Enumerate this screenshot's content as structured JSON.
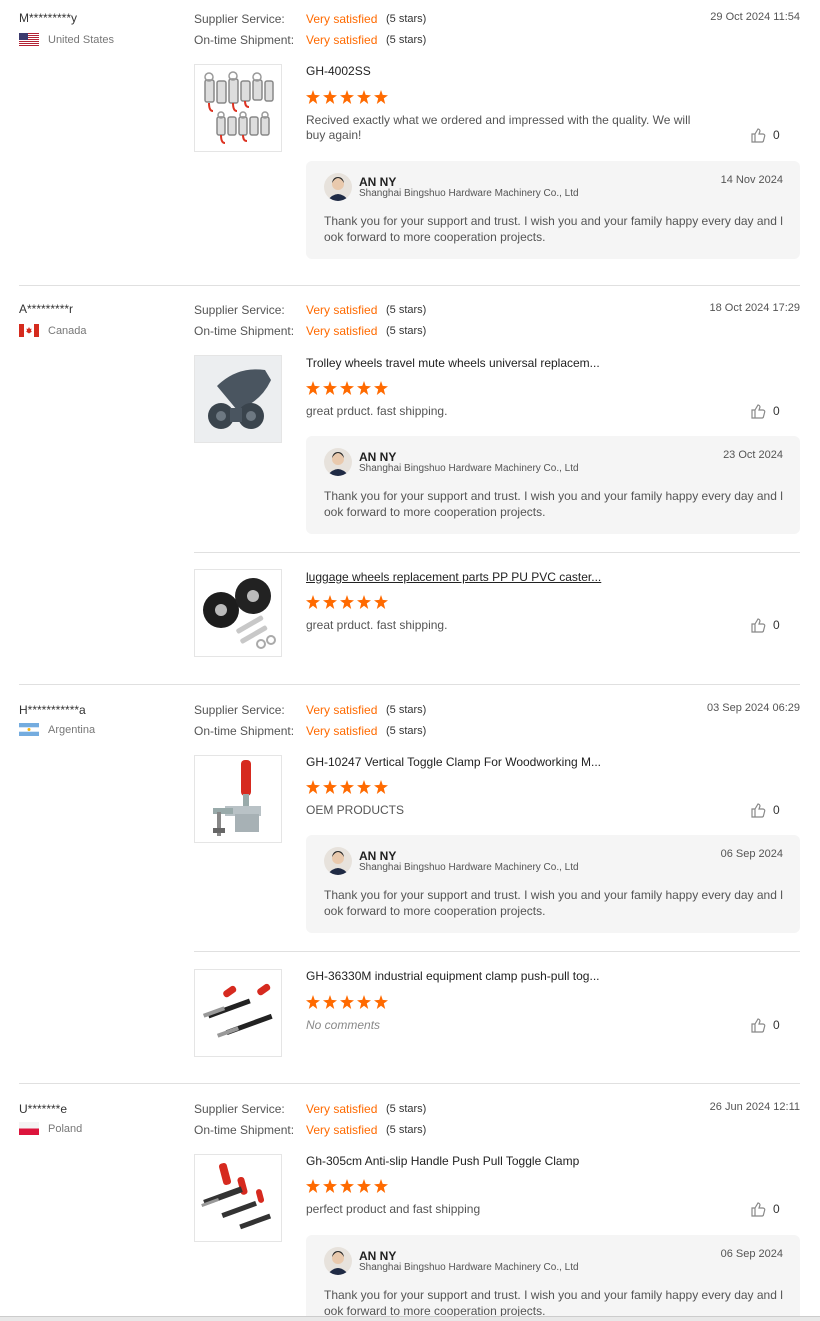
{
  "like_icon": "thumbs-up-icon",
  "colors": {
    "accent": "#ff6a00",
    "reply_bg": "#f5f5f5"
  },
  "labels": {
    "supplier_service": "Supplier Service:",
    "on_time_shipment": "On-time Shipment:"
  },
  "reviews": [
    {
      "buyer": "M*********y",
      "country": "United States",
      "date": "29 Oct 2024 11:54",
      "supplier_value": "Very satisfied",
      "supplier_stars": "(5 stars)",
      "shipment_value": "Very satisfied",
      "shipment_stars": "(5 stars)",
      "products": [
        {
          "title": "GH-4002SS",
          "rating": 5,
          "comment": "Recived exactly what we ordered and impressed with the quality.   We will buy again!",
          "likes": "0",
          "reply": {
            "name": "AN NY",
            "company": "Shanghai Bingshuo Hardware Machinery Co., Ltd",
            "date": "14 Nov 2024",
            "text": "Thank you for your support and trust. I wish you and your family happy every day and look forward to more cooperation projects."
          }
        }
      ]
    },
    {
      "buyer": "A*********r",
      "country": "Canada",
      "date": "18 Oct 2024 17:29",
      "supplier_value": "Very satisfied",
      "supplier_stars": "(5 stars)",
      "shipment_value": "Very satisfied",
      "shipment_stars": "(5 stars)",
      "products": [
        {
          "title": "Trolley wheels travel mute wheels universal replacem...",
          "rating": 5,
          "comment": "great prduct. fast shipping.",
          "likes": "0",
          "reply": {
            "name": "AN NY",
            "company": "Shanghai Bingshuo Hardware Machinery Co., Ltd",
            "date": "23 Oct 2024",
            "text": "Thank you for your support and trust. I wish you and your family happy every day and look forward to more cooperation projects."
          }
        },
        {
          "title": "luggage wheels replacement parts PP PU PVC caster...",
          "rating": 5,
          "comment": "great prduct. fast shipping.",
          "likes": "0"
        }
      ]
    },
    {
      "buyer": "H***********a",
      "country": "Argentina",
      "date": "03 Sep 2024 06:29",
      "supplier_value": "Very satisfied",
      "supplier_stars": "(5 stars)",
      "shipment_value": "Very satisfied",
      "shipment_stars": "(5 stars)",
      "products": [
        {
          "title": "GH-10247 Vertical Toggle Clamp For Woodworking M...",
          "rating": 5,
          "comment": "OEM PRODUCTS",
          "likes": "0",
          "reply": {
            "name": "AN NY",
            "company": "Shanghai Bingshuo Hardware Machinery Co., Ltd",
            "date": "06 Sep 2024",
            "text": "Thank you for your support and trust. I wish you and your family happy every day and look forward to more cooperation projects."
          }
        },
        {
          "title": "GH-36330M industrial equipment clamp push-pull tog...",
          "rating": 5,
          "comment": "No comments",
          "likes": "0"
        }
      ]
    },
    {
      "buyer": "U*******e",
      "country": "Poland",
      "date": "26 Jun 2024 12:11",
      "supplier_value": "Very satisfied",
      "supplier_stars": "(5 stars)",
      "shipment_value": "Very satisfied",
      "shipment_stars": "(5 stars)",
      "products": [
        {
          "title": "Gh-305cm Anti-slip Handle Push Pull Toggle Clamp",
          "rating": 5,
          "comment": "perfect product and fast shipping",
          "likes": "0",
          "reply": {
            "name": "AN NY",
            "company": "Shanghai Bingshuo Hardware Machinery Co., Ltd",
            "date": "06 Sep 2024",
            "text": "Thank you for your support and trust. I wish you and your family happy every day and look forward to more cooperation projects."
          }
        }
      ]
    }
  ]
}
